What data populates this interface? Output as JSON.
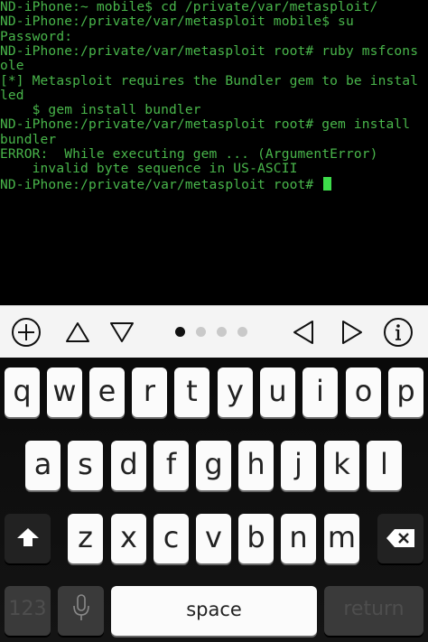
{
  "terminal": {
    "lines": [
      "ND-iPhone:~ mobile$ cd /private/var/metasploit/",
      "ND-iPhone:/private/var/metasploit mobile$ su",
      "Password:",
      "ND-iPhone:/private/var/metasploit root# ruby msfcons",
      "ole",
      "[*] Metasploit requires the Bundler gem to be instal",
      "led",
      "    $ gem install bundler",
      "ND-iPhone:/private/var/metasploit root# gem install",
      "bundler",
      "ERROR:  While executing gem ... (ArgumentError)",
      "    invalid byte sequence in US-ASCII",
      "ND-iPhone:/private/var/metasploit root# "
    ],
    "colors": {
      "text": "#49b64b",
      "cursor": "#3ddc4b",
      "background": "#000000"
    }
  },
  "toolbar": {
    "icons": [
      "plus-circle-icon",
      "triangle-up-icon",
      "triangle-down-icon",
      "triangle-left-icon",
      "triangle-right-icon",
      "info-circle-icon"
    ],
    "page_count": 4,
    "active_page": 1
  },
  "keyboard": {
    "row1": [
      "q",
      "w",
      "e",
      "r",
      "t",
      "y",
      "u",
      "i",
      "o",
      "p"
    ],
    "row2": [
      "a",
      "s",
      "d",
      "f",
      "g",
      "h",
      "j",
      "k",
      "l"
    ],
    "row3": [
      "z",
      "x",
      "c",
      "v",
      "b",
      "n",
      "m"
    ],
    "numbers_label": "123",
    "space_label": "space",
    "return_label": "return",
    "icons": [
      "shift-arrow-icon",
      "delete-icon",
      "microphone-icon"
    ]
  }
}
